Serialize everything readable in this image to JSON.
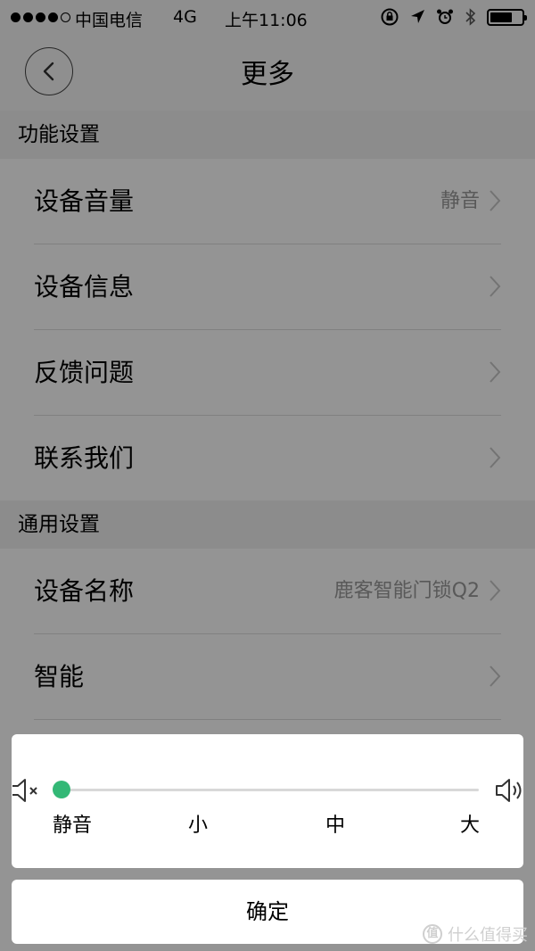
{
  "status_bar": {
    "carrier": "中国电信",
    "network": "4G",
    "time": "上午11:06",
    "icons": [
      "orientation-lock-icon",
      "location-arrow-icon",
      "alarm-icon",
      "bluetooth-icon",
      "battery-icon"
    ]
  },
  "nav": {
    "back_icon": "chevron-left-icon",
    "title": "更多"
  },
  "sections": [
    {
      "header": "功能设置",
      "items": [
        {
          "label": "设备音量",
          "value": "静音"
        },
        {
          "label": "设备信息",
          "value": ""
        },
        {
          "label": "反馈问题",
          "value": ""
        },
        {
          "label": "联系我们",
          "value": ""
        }
      ]
    },
    {
      "header": "通用设置",
      "items": [
        {
          "label": "设备名称",
          "value": "鹿客智能门锁Q2"
        },
        {
          "label": "智能",
          "value": ""
        }
      ]
    }
  ],
  "volume_sheet": {
    "mute_icon": "speaker-mute-icon",
    "loud_icon": "speaker-loud-icon",
    "levels": [
      "静音",
      "小",
      "中",
      "大"
    ],
    "selected_level_index": 0,
    "accent_color": "#33b876"
  },
  "confirm_label": "确定",
  "watermark": {
    "badge": "值",
    "text": "什么值得买"
  }
}
